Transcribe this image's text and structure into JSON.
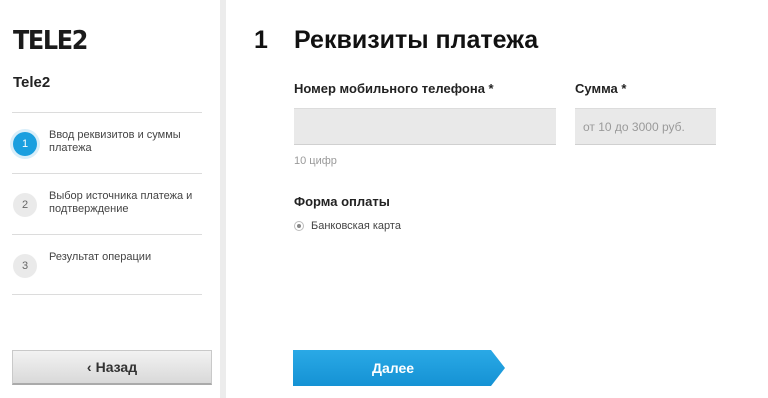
{
  "brand": {
    "logo_text": "TELE2",
    "company_name": "Tele2"
  },
  "steps": [
    {
      "number": "1",
      "label": "Ввод реквизитов и суммы платежа",
      "active": true
    },
    {
      "number": "2",
      "label": "Выбор источника платежа и подтверждение",
      "active": false
    },
    {
      "number": "3",
      "label": "Результат операции",
      "active": false
    }
  ],
  "back_button": {
    "icon": "chevron-left-icon",
    "label": "Назад"
  },
  "main": {
    "step_number": "1",
    "title": "Реквизиты платежа",
    "phone": {
      "label": "Номер мобильного телефона *",
      "value": "",
      "hint": "10 цифр"
    },
    "amount": {
      "label": "Сумма *",
      "placeholder": "от 10 до 3000 руб."
    },
    "payment_form": {
      "label": "Форма оплаты",
      "option": "Банковская карта",
      "selected": true
    },
    "next_button": {
      "label": "Далее"
    }
  },
  "colors": {
    "accent": "#1a9fdf",
    "input_bg": "#e9e9e9"
  }
}
